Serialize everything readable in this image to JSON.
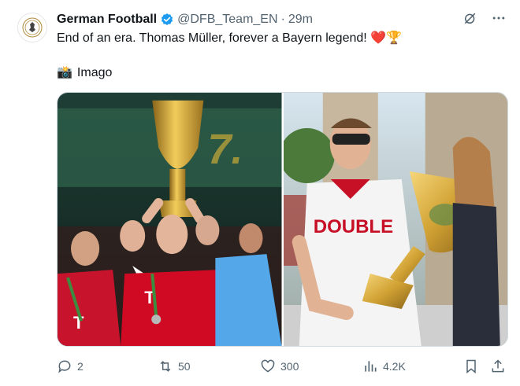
{
  "tweet": {
    "author_name": "German Football",
    "handle": "@DFB_Team_EN",
    "separator": "·",
    "time": "29m",
    "text": "End of an era. Thomas Müller, forever a Bayern legend! ❤️🏆",
    "credit_icon": "📸",
    "credit": "Imago",
    "verified_color": "#1d9bf0"
  },
  "media": {
    "photos": [
      {
        "subject": "players-lifting-trophy"
      },
      {
        "subject": "player-holding-trophy"
      }
    ],
    "jersey_text": "DOUBLE"
  },
  "actions": {
    "replies": "2",
    "reposts": "50",
    "likes": "300",
    "views": "4.2K"
  },
  "colors": {
    "text_primary": "#0f1419",
    "text_secondary": "#536471",
    "accent": "#1d9bf0",
    "bayern_red": "#d10a23",
    "trophy_gold": "#d7a531"
  }
}
